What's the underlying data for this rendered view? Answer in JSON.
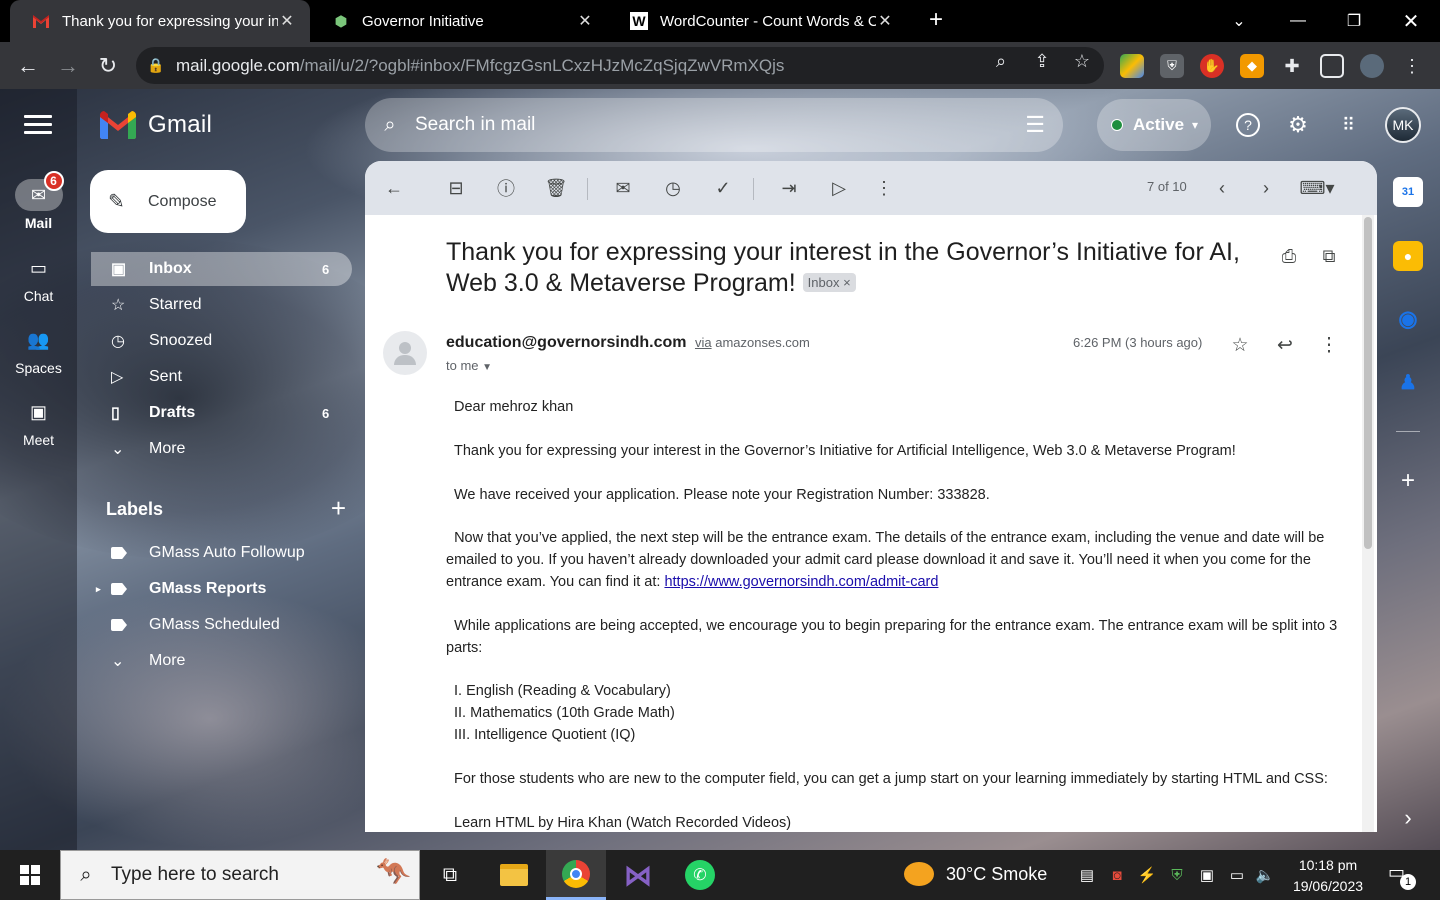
{
  "browser": {
    "tabs": [
      {
        "title": "Thank you for expressing your int",
        "favicon": "gmail-icon",
        "active": true
      },
      {
        "title": "Governor Initiative",
        "favicon": "governor-site-icon",
        "active": false
      },
      {
        "title": "WordCounter - Count Words & C",
        "favicon": "wordcounter-icon",
        "active": false
      }
    ],
    "url_host": "mail.google.com",
    "url_path": "/mail/u/2/?ogbl#inbox/FMfcgzGsnLCxzHJzMcZqSjqZwVRmXQjs"
  },
  "gmail": {
    "brand": "Gmail",
    "search_placeholder": "Search in mail",
    "status": "Active",
    "avatar_initials": "MK",
    "rail": [
      {
        "label": "Mail",
        "badge": "6"
      },
      {
        "label": "Chat"
      },
      {
        "label": "Spaces"
      },
      {
        "label": "Meet"
      }
    ],
    "compose_label": "Compose",
    "folders": [
      {
        "label": "Inbox",
        "count": "6"
      },
      {
        "label": "Starred",
        "count": ""
      },
      {
        "label": "Snoozed",
        "count": ""
      },
      {
        "label": "Sent",
        "count": ""
      },
      {
        "label": "Drafts",
        "count": "6"
      },
      {
        "label": "More",
        "count": ""
      }
    ],
    "labels_title": "Labels",
    "labels": [
      {
        "label": "GMass Auto Followup"
      },
      {
        "label": "GMass Reports"
      },
      {
        "label": "GMass Scheduled"
      },
      {
        "label": "More"
      }
    ],
    "pager": "7 of 10"
  },
  "email": {
    "subject": "Thank you for expressing your interest in the Governor’s Initiative for AI, Web 3.0 & Metaverse Program!",
    "inbox_chip": "Inbox",
    "sender": "education@governorsindh.com",
    "via": "via",
    "via_domain": "amazonses.com",
    "to": "to me",
    "time": "6:26 PM (3 hours ago)",
    "greeting": "Dear mehroz khan",
    "p1": "Thank you for expressing your interest in the Governor’s Initiative for Artificial Intelligence, Web 3.0 & Metaverse Program!",
    "p2": "We have received your application. Please note your Registration Number: 333828.",
    "p3": "Now that you’ve applied, the next step will be the entrance exam. The details of the entrance exam, including the venue and date will be emailed to you. If you haven’t already downloaded your admit card please download it and save it. You’ll need it when you come for the entrance exam. You can find it at: ",
    "p3_link": "https://www.governorsindh.com/admit-card",
    "p4": "While applications are being accepted, we encourage you to begin preparing for the entrance exam. The entrance exam will be split into 3 parts:",
    "parts": [
      "I. English (Reading & Vocabulary)",
      "II. Mathematics (10th Grade Math)",
      "III. Intelligence Quotient (IQ)"
    ],
    "p5": "For those students who are new to the computer field, you can get a jump start on your learning immediately by starting HTML and CSS:",
    "p6": "Learn HTML by Hira Khan (Watch Recorded Videos)"
  },
  "taskbar": {
    "search_placeholder": "Type here to search",
    "weather": "30°C  Smoke",
    "time": "10:18 pm",
    "date": "19/06/2023",
    "notifications": "1"
  }
}
